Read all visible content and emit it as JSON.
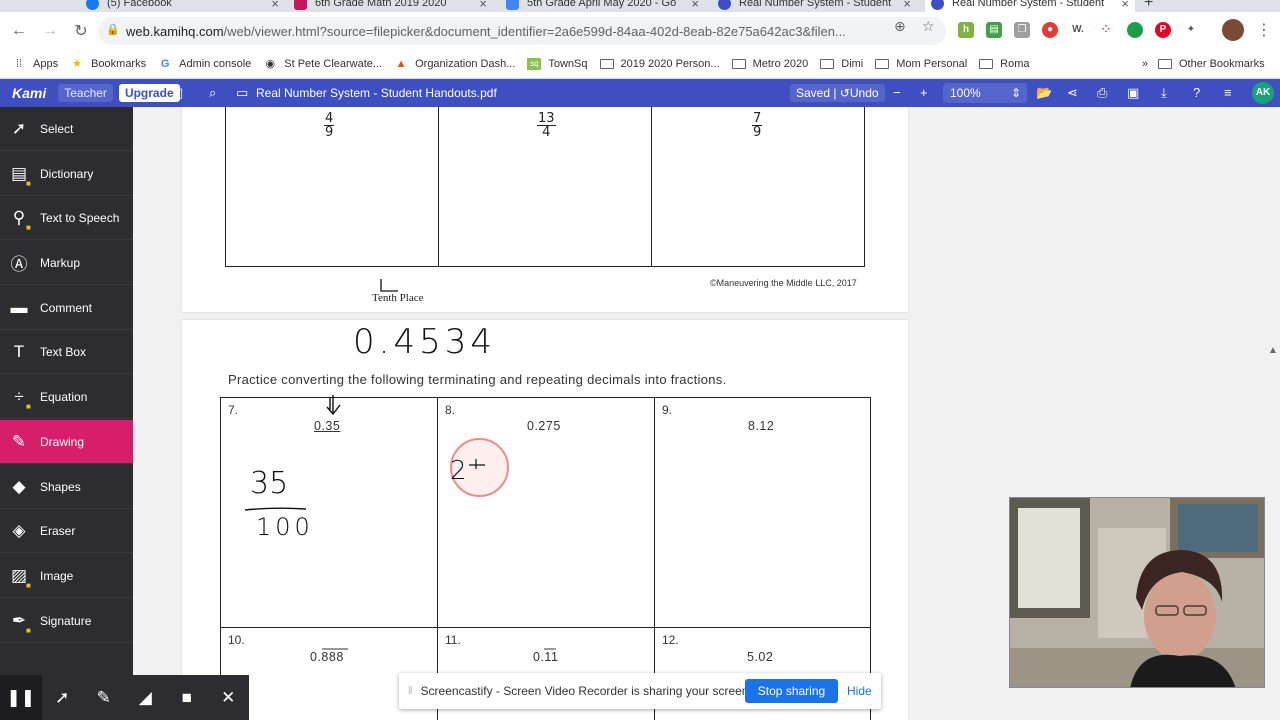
{
  "browser": {
    "tabs": [
      {
        "label": "(5) Facebook",
        "color": "#1877f2"
      },
      {
        "label": "6th Grade Math 2019 2020",
        "color": "#c2185b"
      },
      {
        "label": "5th Grade April May 2020 - Go",
        "color": "#4285f4"
      },
      {
        "label": "Real Number System - Student",
        "color": "#3d4fc1"
      },
      {
        "label": "Real Number System - Student",
        "color": "#3d4fc1"
      }
    ],
    "url_host": "web.kamihq.com",
    "url_path": "/web/viewer.html?source=filepicker&document_identifier=2a6e599d-84aa-402d-8eab-82e75a642ac3&filen...",
    "bookmarks": [
      {
        "label": "Apps",
        "icon": "apps-grid-icon"
      },
      {
        "label": "Bookmarks",
        "icon": "star-icon"
      },
      {
        "label": "Admin console",
        "icon": "google-icon"
      },
      {
        "label": "St Pete Clearwate...",
        "icon": "globe-icon"
      },
      {
        "label": "Organization Dash...",
        "icon": "dash-icon"
      },
      {
        "label": "TownSq",
        "icon": "townsq-icon"
      },
      {
        "label": "2019 2020 Person...",
        "icon": "folder-icon"
      },
      {
        "label": "Metro 2020",
        "icon": "folder-icon"
      },
      {
        "label": "Dimi",
        "icon": "folder-icon"
      },
      {
        "label": "Mom Personal",
        "icon": "folder-icon"
      },
      {
        "label": "Roma",
        "icon": "folder-icon"
      }
    ],
    "bookmarks_overflow": "»",
    "other_bookmarks": "Other Bookmarks"
  },
  "kami": {
    "logo": "Kami",
    "teacher": "Teacher",
    "upgrade": "Upgrade",
    "doc_title": "Real Number System - Student Handouts.pdf",
    "saved": "Saved",
    "undo": "Undo",
    "zoom": "100%",
    "avatar": "AK",
    "accent": "#3d4fc1"
  },
  "tools": [
    {
      "label": "Select",
      "icon": "cursor-icon"
    },
    {
      "label": "Dictionary",
      "icon": "book-icon"
    },
    {
      "label": "Text to Speech",
      "icon": "speech-icon"
    },
    {
      "label": "Markup",
      "icon": "markup-icon"
    },
    {
      "label": "Comment",
      "icon": "comment-icon"
    },
    {
      "label": "Text Box",
      "icon": "text-icon"
    },
    {
      "label": "Equation",
      "icon": "equation-icon"
    },
    {
      "label": "Drawing",
      "icon": "pencil-icon"
    },
    {
      "label": "Shapes",
      "icon": "shapes-icon"
    },
    {
      "label": "Eraser",
      "icon": "eraser-icon"
    },
    {
      "label": "Image",
      "icon": "image-icon"
    },
    {
      "label": "Signature",
      "icon": "signature-icon"
    }
  ],
  "drawing_panel": {
    "size": "1",
    "colors": [
      "#000000",
      "#22e022",
      "#f5078f"
    ]
  },
  "doc": {
    "page1_fractions": [
      {
        "num": "4",
        "den": "9"
      },
      {
        "num": "13",
        "den": "4"
      },
      {
        "num": "7",
        "den": "9"
      }
    ],
    "copyright": "©Maneuvering the Middle LLC, 2017",
    "tenths_note": "Tenth Place",
    "instruction": "Practice converting the following terminating and repeating decimals into fractions.",
    "problems": [
      {
        "num": "7.",
        "value": "0.35"
      },
      {
        "num": "8.",
        "value": "0.275"
      },
      {
        "num": "9.",
        "value": "8.12"
      },
      {
        "num": "10.",
        "value": "0.888"
      },
      {
        "num": "11.",
        "value": "0.11"
      },
      {
        "num": "12.",
        "value": "5.02"
      }
    ],
    "handwriting": {
      "decimal": "0.4534",
      "fraction_num": "35",
      "fraction_den": "100",
      "scribble": "2"
    }
  },
  "screencastify": {
    "message": "Screencastify - Screen Video Recorder is sharing your screen.",
    "stop": "Stop sharing",
    "hide": "Hide"
  }
}
